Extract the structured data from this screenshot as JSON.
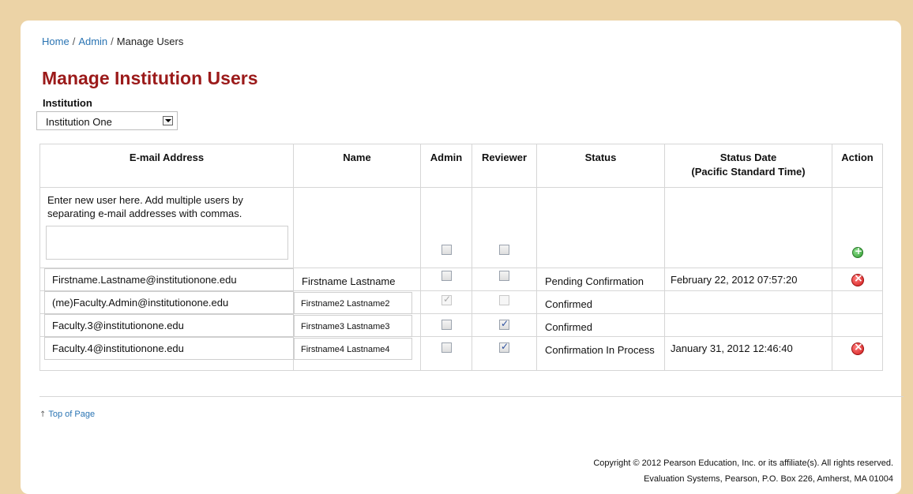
{
  "breadcrumb": {
    "home": "Home",
    "admin": "Admin",
    "current": "Manage Users",
    "separator": "/"
  },
  "page_title": "Manage Institution Users",
  "institution": {
    "label": "Institution",
    "selected": "Institution One"
  },
  "table": {
    "headers": {
      "email": "E-mail Address",
      "name": "Name",
      "admin": "Admin",
      "reviewer": "Reviewer",
      "status": "Status",
      "status_date_line1": "Status Date",
      "status_date_line2": "(Pacific Standard Time)",
      "action": "Action"
    },
    "new_user_hint": "Enter new user here. Add multiple users by separating e-mail addresses with commas.",
    "new_user_value": "",
    "rows": [
      {
        "email": "Firstname.Lastname@institutionone.edu",
        "name": "Firstname Lastname",
        "admin": false,
        "reviewer": false,
        "status": "Pending Confirmation",
        "status_date": "February 22, 2012 07:57:20",
        "action": "delete"
      },
      {
        "email": "(me)Faculty.Admin@institutionone.edu",
        "name": "Firstname2 Lastname2",
        "admin": true,
        "reviewer": false,
        "status": "Confirmed",
        "status_date": "",
        "action": ""
      },
      {
        "email": "Faculty.3@institutionone.edu",
        "name": "Firstname3 Lastname3",
        "admin": false,
        "reviewer": true,
        "status": "Confirmed",
        "status_date": "",
        "action": ""
      },
      {
        "email": "Faculty.4@institutionone.edu",
        "name": "Firstname4 Lastname4",
        "admin": false,
        "reviewer": true,
        "status": "Confirmation In Process",
        "status_date": "January 31, 2012 12:46:40",
        "action": "delete"
      }
    ]
  },
  "footer": {
    "top_link": "Top of Page",
    "copyright_line1": "Copyright © 2012 Pearson Education, Inc. or its affiliate(s). All rights reserved.",
    "copyright_line2": "Evaluation Systems, Pearson, P.O. Box 226, Amherst, MA 01004"
  },
  "colors": {
    "title": "#9b1a1a",
    "link": "#2a74b3",
    "background": "#ecd3a6",
    "add_icon": "#2f9a2f",
    "delete_icon": "#d21c1c"
  },
  "icons": {
    "add": "add-circle-icon",
    "delete": "delete-circle-icon",
    "dropdown": "chevron-down-icon",
    "top": "arrow-up-icon"
  }
}
